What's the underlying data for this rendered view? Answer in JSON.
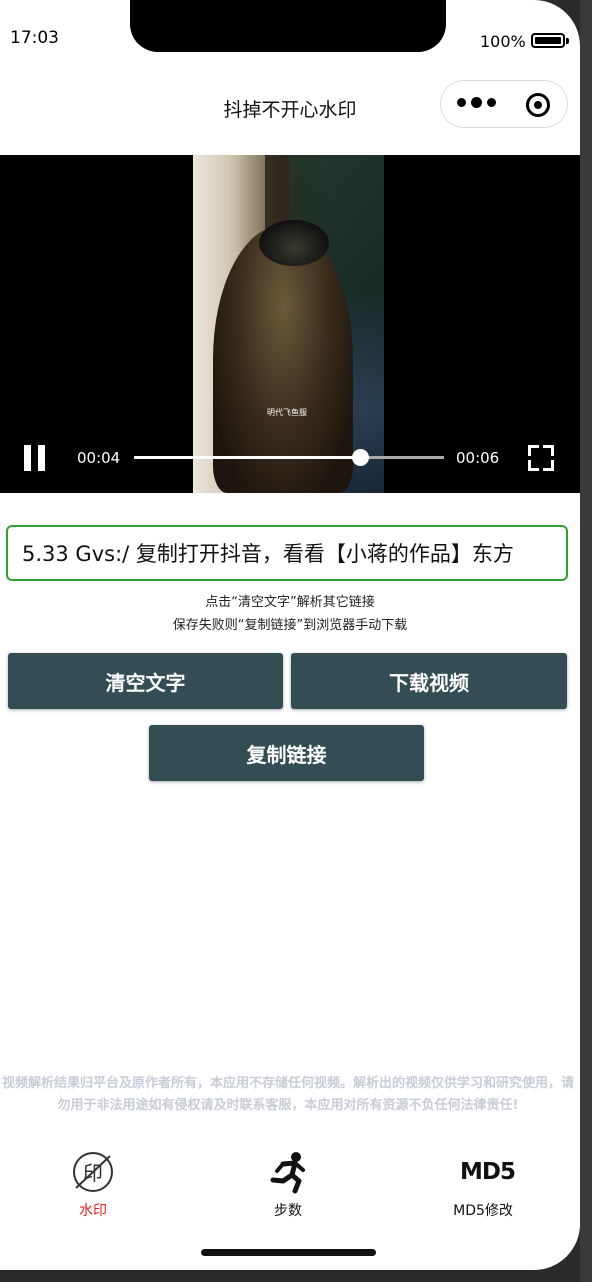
{
  "status_bar": {
    "time": "17:03",
    "battery_text": "100%"
  },
  "nav": {
    "title": "抖掉不开心水印"
  },
  "video": {
    "subtitle": "明代飞鱼服",
    "current_time": "00:04",
    "total_time": "00:06",
    "progress_fraction": 0.73
  },
  "link_input": {
    "value": "5.33 Gvs:/ 复制打开抖音，看看【小蒋的作品】东方"
  },
  "hints": {
    "line1": "点击“清空文字”解析其它链接",
    "line2": "保存失败则“复制链接”到浏览器手动下载"
  },
  "buttons": {
    "clear": "清空文字",
    "download": "下载视频",
    "copy": "复制链接"
  },
  "disclaimer": "视频解析结果归平台及原作者所有，本应用不存储任何视频。解析出的视频仅供学习和研究使用，请勿用于非法用途如有侵权请及时联系客服，本应用对所有资源不负任何法律责任!",
  "tabbar": {
    "items": [
      {
        "label": "水印",
        "active": true,
        "color": "#e02020"
      },
      {
        "label": "步数",
        "active": false,
        "color": "#111111"
      },
      {
        "label": "MD5修改",
        "active": false,
        "color": "#111111",
        "icon_text": "MD5"
      }
    ]
  },
  "colors": {
    "button_bg": "#344d55",
    "input_border": "#2fa12f",
    "accent_red": "#e02020"
  }
}
